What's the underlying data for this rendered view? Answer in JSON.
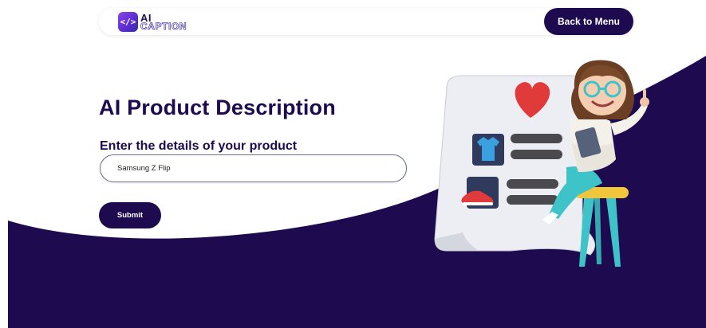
{
  "header": {
    "logo": {
      "line1": "AI",
      "line2": "CAPTION",
      "icon": "code-brackets-icon"
    },
    "back_label": "Back to Menu"
  },
  "main": {
    "title": "AI Product Description",
    "form_label": "Enter the details of your product",
    "product_value": "Samsung Z Flip",
    "submit_label": "Submit"
  },
  "illustration": {
    "name": "girl-with-checklist-illustration"
  },
  "colors": {
    "brand_dark": "#1d0a4f",
    "background": "#ffffff",
    "logo_gradient": [
      "#8b45e6",
      "#2e2f9e"
    ],
    "accent_red": "#e03a3a",
    "accent_teal": "#3ec3c9"
  }
}
